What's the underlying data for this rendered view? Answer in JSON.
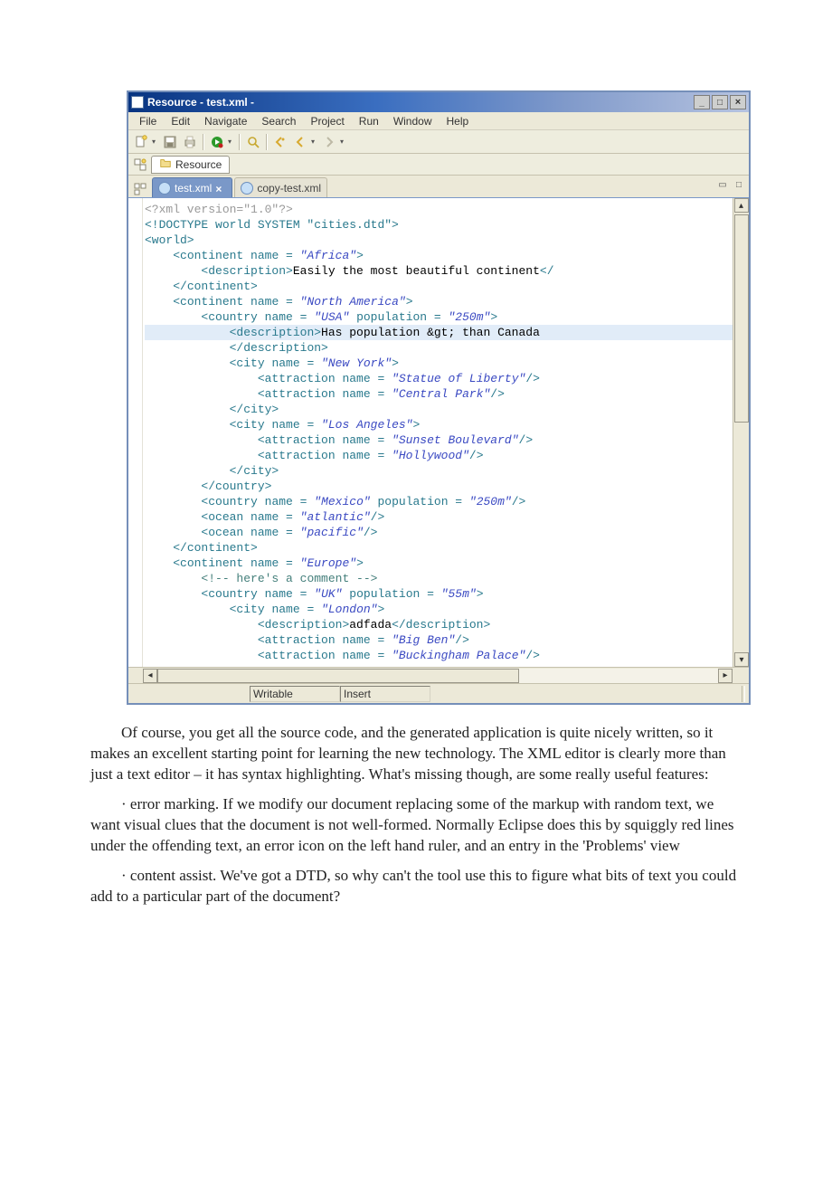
{
  "window": {
    "title": "Resource - test.xml -"
  },
  "menubar": [
    "File",
    "Edit",
    "Navigate",
    "Search",
    "Project",
    "Run",
    "Window",
    "Help"
  ],
  "perspective": {
    "label": "Resource"
  },
  "tabs": [
    {
      "label": "test.xml",
      "active": true
    },
    {
      "label": "copy-test.xml",
      "active": false
    }
  ],
  "code": {
    "lines": [
      {
        "t": "xmldecl",
        "text": "<?xml version=\"1.0\"?>"
      },
      {
        "t": "doctype",
        "text": "<!DOCTYPE world SYSTEM \"cities.dtd\">"
      },
      {
        "t": "tag",
        "indent": 0,
        "content": "<world>"
      },
      {
        "t": "tagattr",
        "indent": 1,
        "tag": "<continent",
        "attrs": " name = ",
        "val": "\"Africa\"",
        "tail": ">"
      },
      {
        "t": "mixed",
        "indent": 2,
        "open": "<description>",
        "text": "Easily the most beautiful continent",
        "close": "</"
      },
      {
        "t": "tag",
        "indent": 1,
        "content": "</continent>"
      },
      {
        "t": "tagattr",
        "indent": 1,
        "tag": "<continent",
        "attrs": " name = ",
        "val": "\"North America\"",
        "tail": ">"
      },
      {
        "t": "tagattr2",
        "indent": 2,
        "tag": "<country",
        "a1n": " name = ",
        "a1v": "\"USA\"",
        "a2n": " population = ",
        "a2v": "\"250m\"",
        "tail": ">"
      },
      {
        "t": "mixed",
        "indent": 3,
        "open": "<description>",
        "text": "Has population &gt; than Canada",
        "close": "",
        "hl": true
      },
      {
        "t": "tag",
        "indent": 3,
        "content": "</description>"
      },
      {
        "t": "tagattr",
        "indent": 3,
        "tag": "<city",
        "attrs": " name = ",
        "val": "\"New York\"",
        "tail": ">"
      },
      {
        "t": "tagattr",
        "indent": 4,
        "tag": "<attraction",
        "attrs": " name = ",
        "val": "\"Statue of Liberty\"",
        "tail": "/>"
      },
      {
        "t": "tagattr",
        "indent": 4,
        "tag": "<attraction",
        "attrs": " name = ",
        "val": "\"Central Park\"",
        "tail": "/>"
      },
      {
        "t": "tag",
        "indent": 3,
        "content": "</city>"
      },
      {
        "t": "tagattr",
        "indent": 3,
        "tag": "<city",
        "attrs": " name = ",
        "val": "\"Los Angeles\"",
        "tail": ">"
      },
      {
        "t": "tagattr",
        "indent": 4,
        "tag": "<attraction",
        "attrs": " name = ",
        "val": "\"Sunset Boulevard\"",
        "tail": "/>"
      },
      {
        "t": "tagattr",
        "indent": 4,
        "tag": "<attraction",
        "attrs": " name = ",
        "val": "\"Hollywood\"",
        "tail": "/>"
      },
      {
        "t": "tag",
        "indent": 3,
        "content": "</city>"
      },
      {
        "t": "tag",
        "indent": 2,
        "content": "</country>"
      },
      {
        "t": "tagattr2",
        "indent": 2,
        "tag": "<country",
        "a1n": " name = ",
        "a1v": "\"Mexico\"",
        "a2n": " population = ",
        "a2v": "\"250m\"",
        "tail": "/>"
      },
      {
        "t": "tagattr",
        "indent": 2,
        "tag": "<ocean",
        "attrs": " name = ",
        "val": "\"atlantic\"",
        "tail": "/>"
      },
      {
        "t": "tagattr",
        "indent": 2,
        "tag": "<ocean",
        "attrs": " name = ",
        "val": "\"pacific\"",
        "tail": "/>"
      },
      {
        "t": "tag",
        "indent": 1,
        "content": "</continent>"
      },
      {
        "t": "tagattr",
        "indent": 1,
        "tag": "<continent",
        "attrs": " name = ",
        "val": "\"Europe\"",
        "tail": ">"
      },
      {
        "t": "comment",
        "indent": 2,
        "text": "<!-- here's a comment -->"
      },
      {
        "t": "tagattr2",
        "indent": 2,
        "tag": "<country",
        "a1n": " name = ",
        "a1v": "\"UK\"",
        "a2n": " population = ",
        "a2v": "\"55m\"",
        "tail": ">"
      },
      {
        "t": "tagattr",
        "indent": 3,
        "tag": "<city",
        "attrs": " name = ",
        "val": "\"London\"",
        "tail": ">"
      },
      {
        "t": "mixed",
        "indent": 4,
        "open": "<description>",
        "text": "adfada",
        "close": "</description>"
      },
      {
        "t": "tagattr",
        "indent": 4,
        "tag": "<attraction",
        "attrs": " name = ",
        "val": "\"Big Ben\"",
        "tail": "/>"
      },
      {
        "t": "tagattr",
        "indent": 4,
        "tag": "<attraction",
        "attrs": " name = ",
        "val": "\"Buckingham Palace\"",
        "tail": "/>"
      }
    ]
  },
  "statusbar": {
    "left": "Writable",
    "mid": "Insert"
  },
  "doc": {
    "p1": "Of course, you get all the source code, and the generated application is quite nicely written, so it makes an excellent starting point for learning the new technology. The XML editor is clearly more than just a text editor – it has syntax highlighting. What's missing though, are some really useful features:",
    "p2": "· error marking. If we modify our document replacing some of the markup with random text, we want visual clues that the document is not well-formed. Normally Eclipse does this by squiggly red lines under the offending text, an error icon on the left hand ruler, and an entry in the 'Problems' view",
    "p3": "· content assist. We've got a DTD, so why can't the tool use this to figure what bits of text you could add to a particular part of the document?"
  }
}
